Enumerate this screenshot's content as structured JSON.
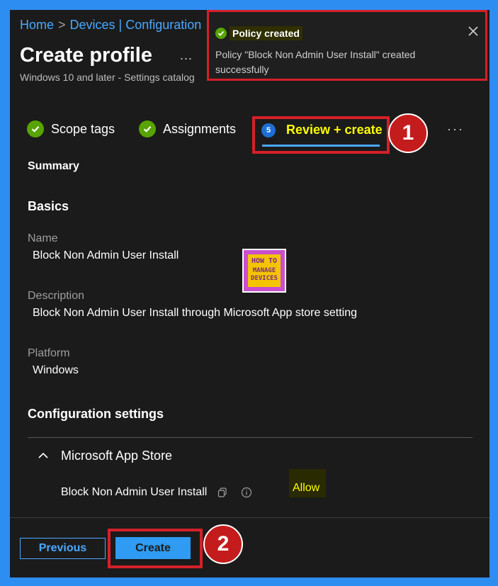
{
  "breadcrumb": {
    "home": "Home",
    "separator": ">",
    "devices_config": "Devices | Configuration"
  },
  "page": {
    "title": "Create profile",
    "more": "...",
    "subtitle": "Windows 10 and later - Settings catalog"
  },
  "toast": {
    "title": "Policy created",
    "message": "Policy \"Block Non Admin User Install\" created successfully"
  },
  "steps": [
    {
      "label": "Scope tags",
      "status": "complete"
    },
    {
      "label": "Assignments",
      "status": "complete"
    },
    {
      "label": "Review + create",
      "number": "5",
      "status": "current"
    }
  ],
  "steps_more": "···",
  "annotations": {
    "step_marker": "1",
    "create_marker": "2"
  },
  "summary": {
    "heading": "Summary",
    "basics_heading": "Basics",
    "name_label": "Name",
    "name_value": "Block Non Admin User Install",
    "description_label": "Description",
    "description_value": "Block Non Admin User Install through Microsoft App store setting",
    "platform_label": "Platform",
    "platform_value": "Windows",
    "config_heading": "Configuration settings",
    "category": "Microsoft App Store",
    "setting_name": "Block Non Admin User Install",
    "setting_value": "Allow"
  },
  "logo": {
    "line1": "HOW TO",
    "line2": "MANAGE",
    "line3": "DEVICES"
  },
  "footer": {
    "previous_label": "Previous",
    "create_label": "Create"
  },
  "colors": {
    "frame": "#2e8df0",
    "background": "#1b1b1b",
    "accent_blue": "#4aa8ff",
    "success_green": "#57a300",
    "highlight_yellow": "#ffff00",
    "annotation_red": "#d42028"
  }
}
